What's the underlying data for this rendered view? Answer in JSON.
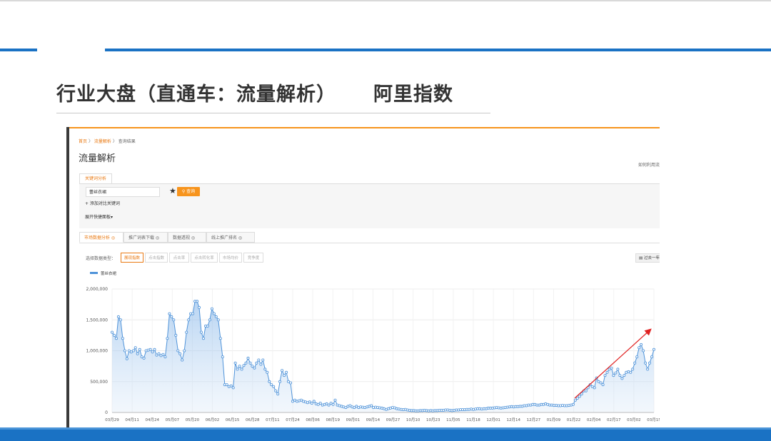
{
  "slide": {
    "title": "行业大盘（直通车：流量解析）     阿里指数",
    "colors": {
      "accent": "#1a72c4",
      "title": "#333333"
    }
  },
  "screenshot": {
    "breadcrumb": {
      "home": "首页",
      "sep": "〉",
      "section": "流量解析",
      "current": "查询结果"
    },
    "page_title": "流量解析",
    "help_link": "如何利用流",
    "keyword_tab": "关键词分析",
    "search": {
      "value": "蕾丝衣裙",
      "button": "查询",
      "star_icon": "star-icon"
    },
    "add_compare": "+ 添加对比关键词",
    "expand_panel": "展开快捷面板▾",
    "tabs": [
      {
        "label": "市场数据分析 ◎",
        "active": true
      },
      {
        "label": "推广词表下载 ◎",
        "active": false
      },
      {
        "label": "数据透视 ◎",
        "active": false
      },
      {
        "label": "线上推广排名 ◎",
        "active": false
      }
    ],
    "data_type_label": "选择数据类型：",
    "data_types": [
      {
        "label": "展现指数",
        "active": true
      },
      {
        "label": "点击指数",
        "active": false
      },
      {
        "label": "点击率",
        "active": false
      },
      {
        "label": "点击转化率",
        "active": false
      },
      {
        "label": "市场均价",
        "active": false
      },
      {
        "label": "竞争度",
        "active": false
      }
    ],
    "export_button": "▤ 过去一年"
  },
  "chart_data": {
    "type": "area",
    "series": [
      {
        "name": "蕾丝衣裙",
        "values": [
          1300000,
          1250000,
          1200000,
          1550000,
          1500000,
          1200000,
          1000000,
          870000,
          1000000,
          980000,
          1000000,
          1050000,
          950000,
          1020000,
          900000,
          880000,
          1000000,
          1010000,
          1020000,
          980000,
          1020000,
          930000,
          950000,
          920000,
          940000,
          900000,
          1200000,
          1600000,
          1550000,
          1500000,
          1250000,
          1000000,
          950000,
          850000,
          1000000,
          1300000,
          1500000,
          1600000,
          1600000,
          1800000,
          1800000,
          1700000,
          1300000,
          1200000,
          1400000,
          1400000,
          1500000,
          1680000,
          1600000,
          1550000,
          1500000,
          1200000,
          900000,
          450000,
          450000,
          420000,
          430000,
          400000,
          800000,
          700000,
          750000,
          700000,
          760000,
          800000,
          880000,
          800000,
          750000,
          720000,
          800000,
          850000,
          780000,
          850000,
          700000,
          650000,
          500000,
          450000,
          420000,
          350000,
          300000,
          500000,
          680000,
          600000,
          650000,
          500000,
          480000,
          180000,
          200000,
          180000,
          190000,
          200000,
          180000,
          170000,
          160000,
          170000,
          150000,
          180000,
          140000,
          130000,
          150000,
          120000,
          130000,
          140000,
          120000,
          150000,
          130000,
          200000,
          120000,
          110000,
          100000,
          90000,
          80000,
          100000,
          110000,
          90000,
          80000,
          100000,
          80000,
          90000,
          85000,
          80000,
          90000,
          100000,
          110000,
          80000,
          85000,
          80000,
          75000,
          70000,
          60000,
          50000,
          60000,
          70000,
          80000,
          75000,
          60000,
          55000,
          50000,
          45000,
          50000,
          40000,
          35000,
          30000,
          30000,
          25000,
          25000,
          30000,
          30000,
          35000,
          30000,
          25000,
          30000,
          25000,
          30000,
          30000,
          35000,
          35000,
          35000,
          40000,
          40000,
          35000,
          30000,
          35000,
          40000,
          40000,
          45000,
          45000,
          45000,
          50000,
          50000,
          55000,
          50000,
          55000,
          60000,
          60000,
          55000,
          60000,
          60000,
          70000,
          70000,
          70000,
          75000,
          80000,
          75000,
          70000,
          75000,
          80000,
          85000,
          90000,
          95000,
          90000,
          95000,
          95000,
          100000,
          100000,
          110000,
          110000,
          120000,
          120000,
          130000,
          130000,
          120000,
          120000,
          130000,
          130000,
          140000,
          130000,
          120000,
          120000,
          115000,
          115000,
          110000,
          110000,
          115000,
          110000,
          110000,
          115000,
          120000,
          130000,
          200000,
          230000,
          260000,
          300000,
          350000,
          350000,
          400000,
          450000,
          420000,
          400000,
          560000,
          500000,
          480000,
          450000,
          600000,
          650000,
          700000,
          720000,
          600000,
          640000,
          700000,
          600000,
          550000,
          600000,
          650000,
          660000,
          650000,
          700000,
          800000,
          900000,
          1050000,
          1100000,
          1000000,
          800000,
          700000,
          800000,
          900000,
          1020000
        ],
        "color": "#4f93d9"
      }
    ],
    "x_labels": [
      "03月29",
      "04月11",
      "04月24",
      "05月07",
      "05月20",
      "06月02",
      "06月15",
      "06月28",
      "07月11",
      "07月24",
      "08月06",
      "08月19",
      "09月01",
      "09月14",
      "09月27",
      "10月10",
      "10月23",
      "11月05",
      "11月18",
      "12月01",
      "12月14",
      "12月27",
      "01月09",
      "01月22",
      "02月04",
      "02月17",
      "03月02",
      "03月15"
    ],
    "y_ticks": [
      "0",
      "500,000",
      "1,000,000",
      "1,500,000",
      "2,000,000"
    ],
    "ylim": [
      0,
      2000000
    ],
    "grid": true,
    "trend_arrow_color": "#e02020"
  }
}
